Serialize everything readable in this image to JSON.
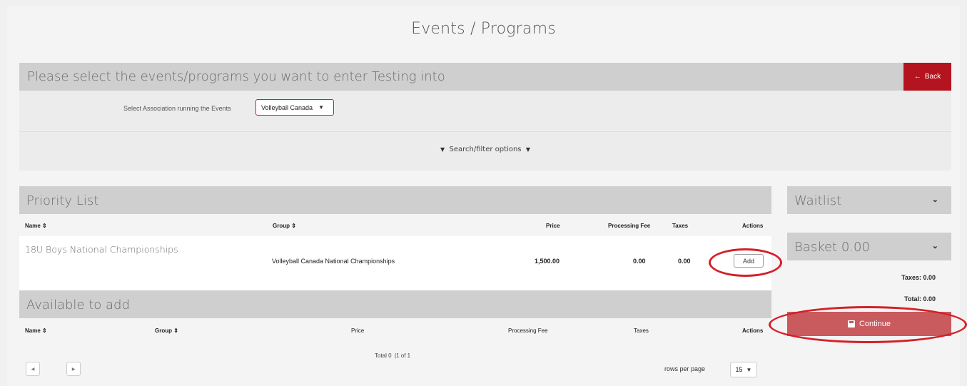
{
  "page": {
    "title": "Events / Programs"
  },
  "select_section": {
    "title": "Please select the events/programs you want to enter Testing into",
    "back_label": "Back",
    "association_label": "Select Association running the Events",
    "association_value": "Volleyball Canada",
    "filter_label": "Search/filter options"
  },
  "priority_list": {
    "title": "Priority List",
    "headers": {
      "name": "Name",
      "group": "Group",
      "price": "Price",
      "processing_fee": "Processing Fee",
      "taxes": "Taxes",
      "actions": "Actions"
    },
    "rows": [
      {
        "name": "18U Boys National Championships",
        "group": "Volleyball Canada National Championships",
        "price": "1,500.00",
        "processing_fee": "0.00",
        "taxes": "0.00",
        "action": "Add"
      }
    ]
  },
  "available": {
    "title": "Available to add",
    "headers": {
      "name": "Name",
      "group": "Group",
      "price": "Price",
      "processing_fee": "Processing Fee",
      "taxes": "Taxes",
      "actions": "Actions"
    },
    "pagination": {
      "total_text": "Total 0",
      "page_text": "1 of 1",
      "rows_per_page_label": "rows per page",
      "rows_per_page_value": "15"
    }
  },
  "sidebar": {
    "waitlist_title": "Waitlist",
    "basket_title": "Basket 0.00",
    "taxes_text": "Taxes: 0.00",
    "total_text": "Total: 0.00",
    "continue_label": "Continue"
  },
  "colors": {
    "brand_red": "#b4141f",
    "highlight_ring": "#d42029",
    "continue_bg": "#c95a5e"
  },
  "icons": [
    "arrow-left-icon",
    "caret-down-icon",
    "sort-icon",
    "chevron-down-icon",
    "save-icon",
    "chevron-left-icon",
    "chevron-right-icon"
  ]
}
